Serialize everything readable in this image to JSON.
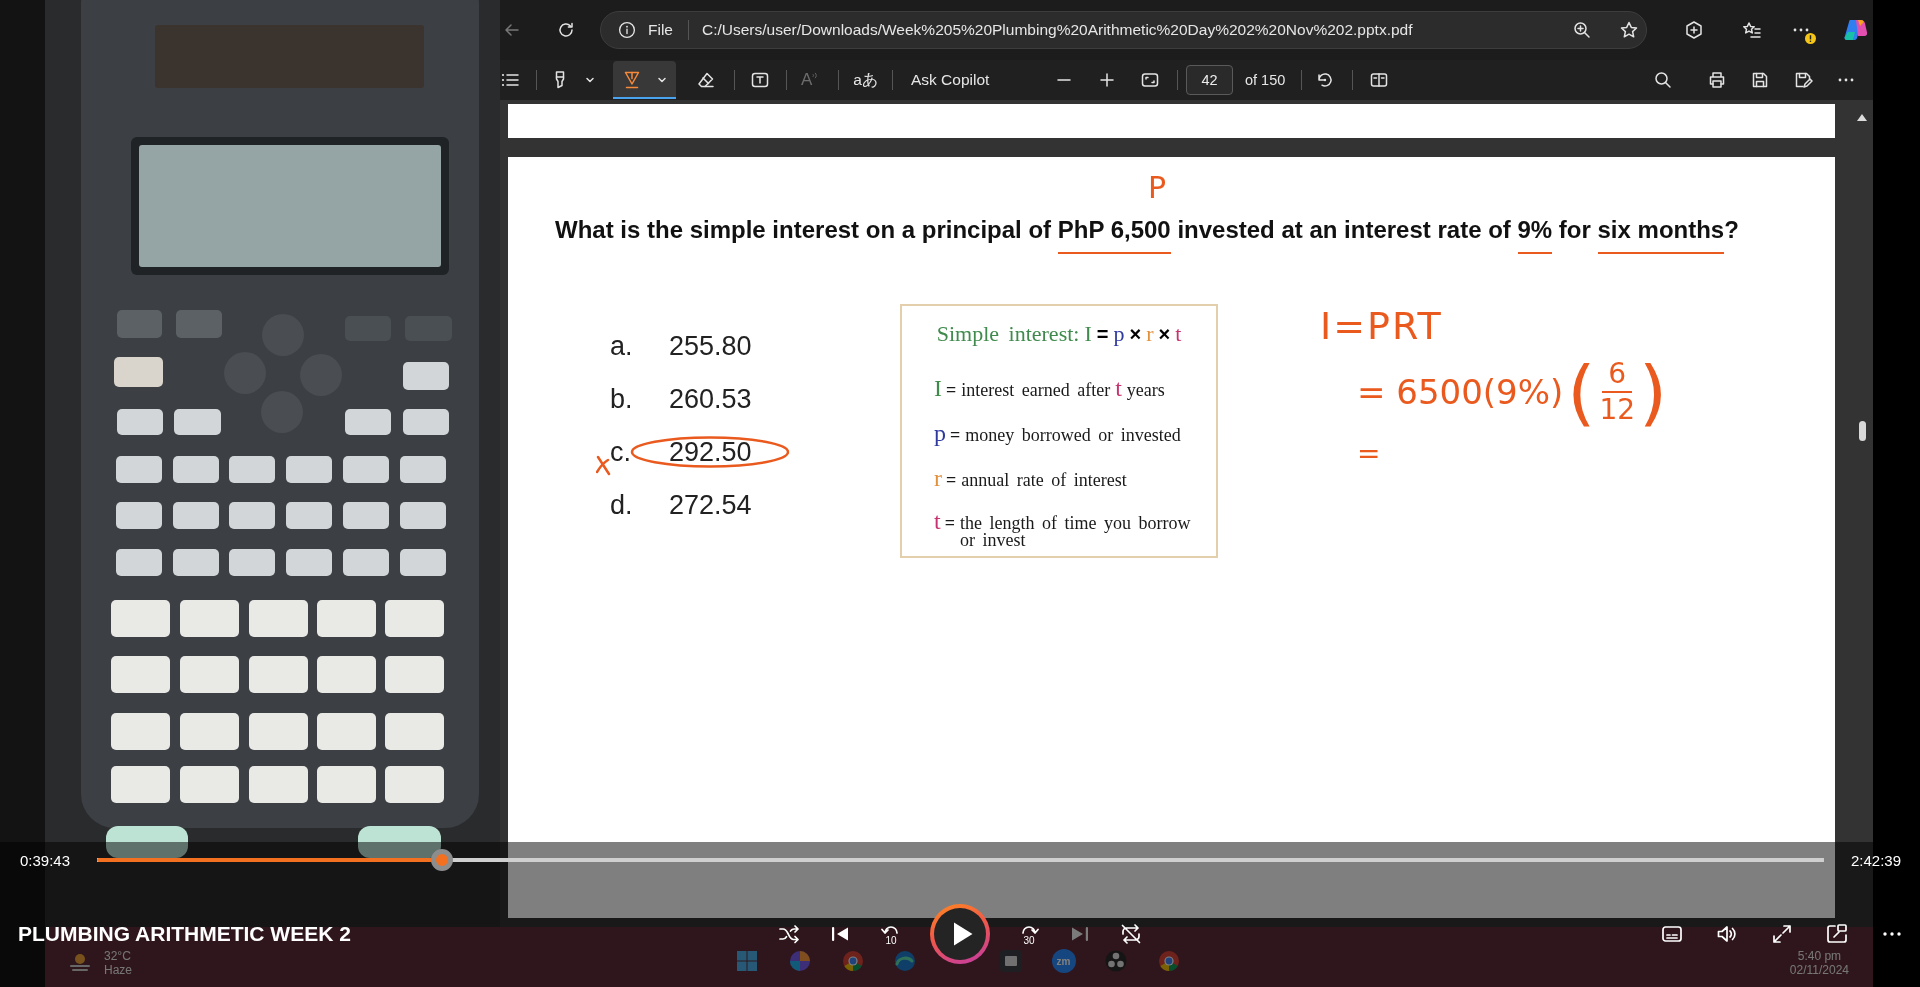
{
  "browser": {
    "back": {
      "disabled": true
    },
    "address_bar": {
      "scheme": "File",
      "url": "C:/Users/user/Downloads/Week%205%20Plumbing%20Arithmetic%20Day%202%20Nov%202.pptx.pdf"
    },
    "toolbar": {
      "tools": [
        {
          "kind": "highlight",
          "selected": false
        },
        {
          "kind": "draw",
          "selected": true
        }
      ],
      "read_aloud": {
        "label": "A",
        "disabled": true
      },
      "translate": {
        "label": "aあ"
      },
      "copilot": {
        "label": "Ask Copilot"
      },
      "page": {
        "value": "42",
        "count": "of 150"
      }
    }
  },
  "pdf": {
    "question": [
      {
        "text": "What is the simple interest on a principal of ",
        "underlined": false
      },
      {
        "text": "PhP 6,500",
        "underlined": true
      },
      {
        "text": " invested at an interest rate of ",
        "underlined": false
      },
      {
        "text": "9%",
        "underlined": true
      },
      {
        "text": " for ",
        "underlined": false
      },
      {
        "text": "six months",
        "underlined": true
      },
      {
        "text": "?",
        "underlined": false
      }
    ],
    "options": [
      {
        "letter": "a.",
        "value": "255.80",
        "marked": false
      },
      {
        "letter": "b.",
        "value": "260.53",
        "marked": false
      },
      {
        "letter": "c.",
        "value": "292.50",
        "marked": true
      },
      {
        "letter": "d.",
        "value": "272.54",
        "marked": false
      }
    ],
    "formula_box": {
      "title": [
        {
          "text": "Simple interest:",
          "kind": "term",
          "color": "#3f8a4c"
        },
        {
          "text": "I",
          "kind": "term",
          "color": "#3f8a4c"
        },
        {
          "text": "=",
          "kind": "operator",
          "color": "#000000"
        },
        {
          "text": "p",
          "kind": "term",
          "color": "#2e3a9e"
        },
        {
          "text": "×",
          "kind": "operator",
          "color": "#000000"
        },
        {
          "text": "r",
          "kind": "term",
          "color": "#e3903d"
        },
        {
          "text": "×",
          "kind": "operator",
          "color": "#000000"
        },
        {
          "text": "t",
          "kind": "term",
          "color": "#c7336e"
        }
      ],
      "definitions": [
        {
          "symbol": {
            "text": "I",
            "color": "#3f8a4c"
          },
          "equals": "=",
          "parts": [
            {
              "text": "interest earned after"
            },
            {
              "text": "t",
              "color": "#c7336e"
            },
            {
              "text": "years"
            }
          ]
        },
        {
          "symbol": {
            "text": "p",
            "color": "#2e3a9e"
          },
          "equals": "=",
          "parts": [
            {
              "text": "money borrowed or invested"
            }
          ]
        },
        {
          "symbol": {
            "text": "r",
            "color": "#e3903d"
          },
          "equals": "=",
          "parts": [
            {
              "text": "annual rate of interest"
            }
          ]
        },
        {
          "symbol": {
            "text": "t",
            "color": "#c7336e"
          },
          "equals": "=",
          "parts": [
            {
              "text": "the length of time you borrow or invest"
            }
          ]
        }
      ]
    },
    "annotations": {
      "mark": "P",
      "lines": [
        {
          "text": "I=PRT"
        },
        {
          "text": "= 6500(9%)",
          "open": "(",
          "fraction": {
            "numerator": "6",
            "denominator": "12"
          },
          "close": ")"
        },
        {
          "text": "="
        }
      ]
    }
  },
  "taskbar": {
    "temperature": "32°C",
    "weather": "Haze",
    "apps": [
      {
        "kind": "start"
      },
      {
        "kind": "colorful"
      },
      {
        "kind": "wheel"
      },
      {
        "kind": "wave"
      },
      {
        "kind": "tile"
      },
      {
        "kind": "badge",
        "label": "zm"
      },
      {
        "kind": "aperture"
      },
      {
        "kind": "wheel"
      }
    ],
    "time": "5:40 pm",
    "date": "02/11/2024"
  },
  "player": {
    "elapsed": "0:39:43",
    "duration": "2:42:39",
    "progress": {
      "level": 0.2
    },
    "title": "PLUMBING ARITHMETIC WEEK 2",
    "controls": [
      {
        "kind": "shuffle",
        "disabled": false
      },
      {
        "kind": "previous",
        "disabled": false
      },
      {
        "kind": "skip_back",
        "label": "10",
        "disabled": false
      },
      {
        "kind": "play",
        "disabled": false
      },
      {
        "kind": "skip_forward",
        "label": "30",
        "disabled": false
      },
      {
        "kind": "next",
        "disabled": true
      },
      {
        "kind": "repeat",
        "disabled": false
      }
    ],
    "side_controls": [
      {
        "kind": "captions"
      },
      {
        "kind": "volume"
      },
      {
        "kind": "fullscreen"
      },
      {
        "kind": "mini_player"
      },
      {
        "kind": "more"
      }
    ]
  }
}
